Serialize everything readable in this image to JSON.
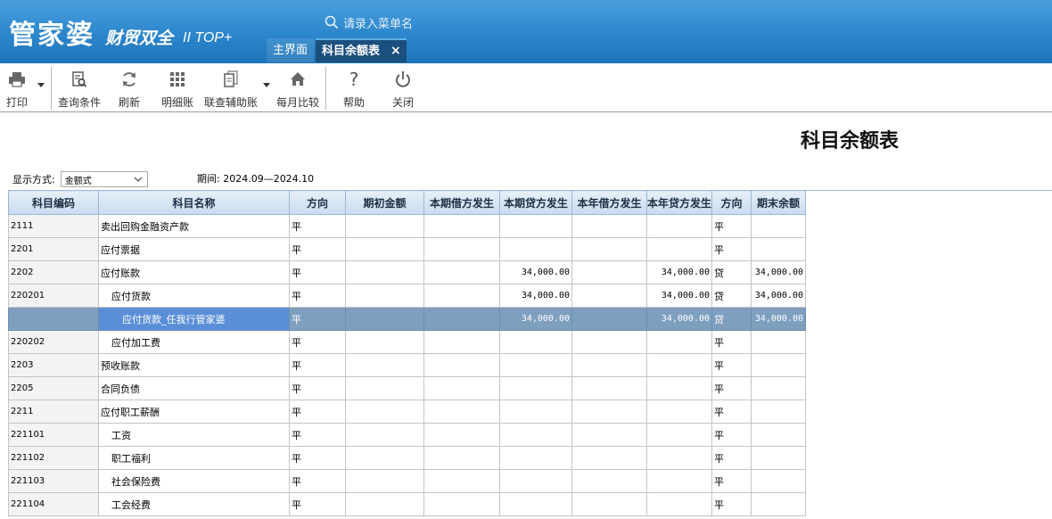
{
  "header": {
    "logo_main": "管家婆",
    "logo_sub": "财贸双全",
    "logo_version": "II TOP+",
    "search_placeholder": "请录入菜单名",
    "tabs": [
      {
        "label": "主界面"
      },
      {
        "label": "科目余额表"
      }
    ],
    "close_symbol": "×"
  },
  "toolbar": {
    "items": [
      {
        "label": "打印",
        "icon": "printer-icon"
      },
      {
        "label": "查询条件",
        "icon": "query-icon"
      },
      {
        "label": "刷新",
        "icon": "refresh-icon"
      },
      {
        "label": "明细账",
        "icon": "grid-icon"
      },
      {
        "label": "联查辅助账",
        "icon": "documents-icon"
      },
      {
        "label": "每月比较",
        "icon": "home-icon"
      },
      {
        "label": "帮助",
        "icon": "help-icon"
      },
      {
        "label": "关闭",
        "icon": "power-icon"
      }
    ]
  },
  "report": {
    "title": "科目余额表",
    "display_mode_label": "显示方式:",
    "display_mode_value": "金额式",
    "period_label": "期间: 2024.09—2024.10"
  },
  "table": {
    "columns": [
      "科目编码",
      "科目名称",
      "方向",
      "期初金额",
      "本期借方发生",
      "本期贷方发生",
      "本年借方发生",
      "本年贷方发生",
      "方向",
      "期末余额"
    ],
    "rows": [
      {
        "code": "2111",
        "name": "卖出回购金融资产款",
        "level": 1,
        "dir": "平",
        "open": "",
        "cur_debit": "",
        "cur_credit": "",
        "yr_debit": "",
        "yr_credit": "",
        "end_dir": "平",
        "end_bal": ""
      },
      {
        "code": "2201",
        "name": "应付票据",
        "level": 1,
        "dir": "平",
        "open": "",
        "cur_debit": "",
        "cur_credit": "",
        "yr_debit": "",
        "yr_credit": "",
        "end_dir": "平",
        "end_bal": ""
      },
      {
        "code": "2202",
        "name": "应付账款",
        "level": 1,
        "dir": "平",
        "open": "",
        "cur_debit": "",
        "cur_credit": "34,000.00",
        "yr_debit": "",
        "yr_credit": "34,000.00",
        "end_dir": "贷",
        "end_bal": "34,000.00"
      },
      {
        "code": "220201",
        "name": "应付货款",
        "level": 2,
        "dir": "平",
        "open": "",
        "cur_debit": "",
        "cur_credit": "34,000.00",
        "yr_debit": "",
        "yr_credit": "34,000.00",
        "end_dir": "贷",
        "end_bal": "34,000.00"
      },
      {
        "code": "",
        "name": "应付货款_任我行管家婆",
        "level": 3,
        "dir": "平",
        "open": "",
        "cur_debit": "",
        "cur_credit": "34,000.00",
        "yr_debit": "",
        "yr_credit": "34,000.00",
        "end_dir": "贷",
        "end_bal": "34,000.00",
        "selected": true
      },
      {
        "code": "220202",
        "name": "应付加工费",
        "level": 2,
        "dir": "平",
        "open": "",
        "cur_debit": "",
        "cur_credit": "",
        "yr_debit": "",
        "yr_credit": "",
        "end_dir": "平",
        "end_bal": ""
      },
      {
        "code": "2203",
        "name": "预收账款",
        "level": 1,
        "dir": "平",
        "open": "",
        "cur_debit": "",
        "cur_credit": "",
        "yr_debit": "",
        "yr_credit": "",
        "end_dir": "平",
        "end_bal": ""
      },
      {
        "code": "2205",
        "name": "合同负债",
        "level": 1,
        "dir": "平",
        "open": "",
        "cur_debit": "",
        "cur_credit": "",
        "yr_debit": "",
        "yr_credit": "",
        "end_dir": "平",
        "end_bal": ""
      },
      {
        "code": "2211",
        "name": "应付职工薪酬",
        "level": 1,
        "dir": "平",
        "open": "",
        "cur_debit": "",
        "cur_credit": "",
        "yr_debit": "",
        "yr_credit": "",
        "end_dir": "平",
        "end_bal": ""
      },
      {
        "code": "221101",
        "name": "工资",
        "level": 2,
        "dir": "平",
        "open": "",
        "cur_debit": "",
        "cur_credit": "",
        "yr_debit": "",
        "yr_credit": "",
        "end_dir": "平",
        "end_bal": ""
      },
      {
        "code": "221102",
        "name": "职工福利",
        "level": 2,
        "dir": "平",
        "open": "",
        "cur_debit": "",
        "cur_credit": "",
        "yr_debit": "",
        "yr_credit": "",
        "end_dir": "平",
        "end_bal": ""
      },
      {
        "code": "221103",
        "name": "社会保险费",
        "level": 2,
        "dir": "平",
        "open": "",
        "cur_debit": "",
        "cur_credit": "",
        "yr_debit": "",
        "yr_credit": "",
        "end_dir": "平",
        "end_bal": ""
      },
      {
        "code": "221104",
        "name": "工会经费",
        "level": 2,
        "dir": "平",
        "open": "",
        "cur_debit": "",
        "cur_credit": "",
        "yr_debit": "",
        "yr_credit": "",
        "end_dir": "平",
        "end_bal": ""
      }
    ]
  }
}
